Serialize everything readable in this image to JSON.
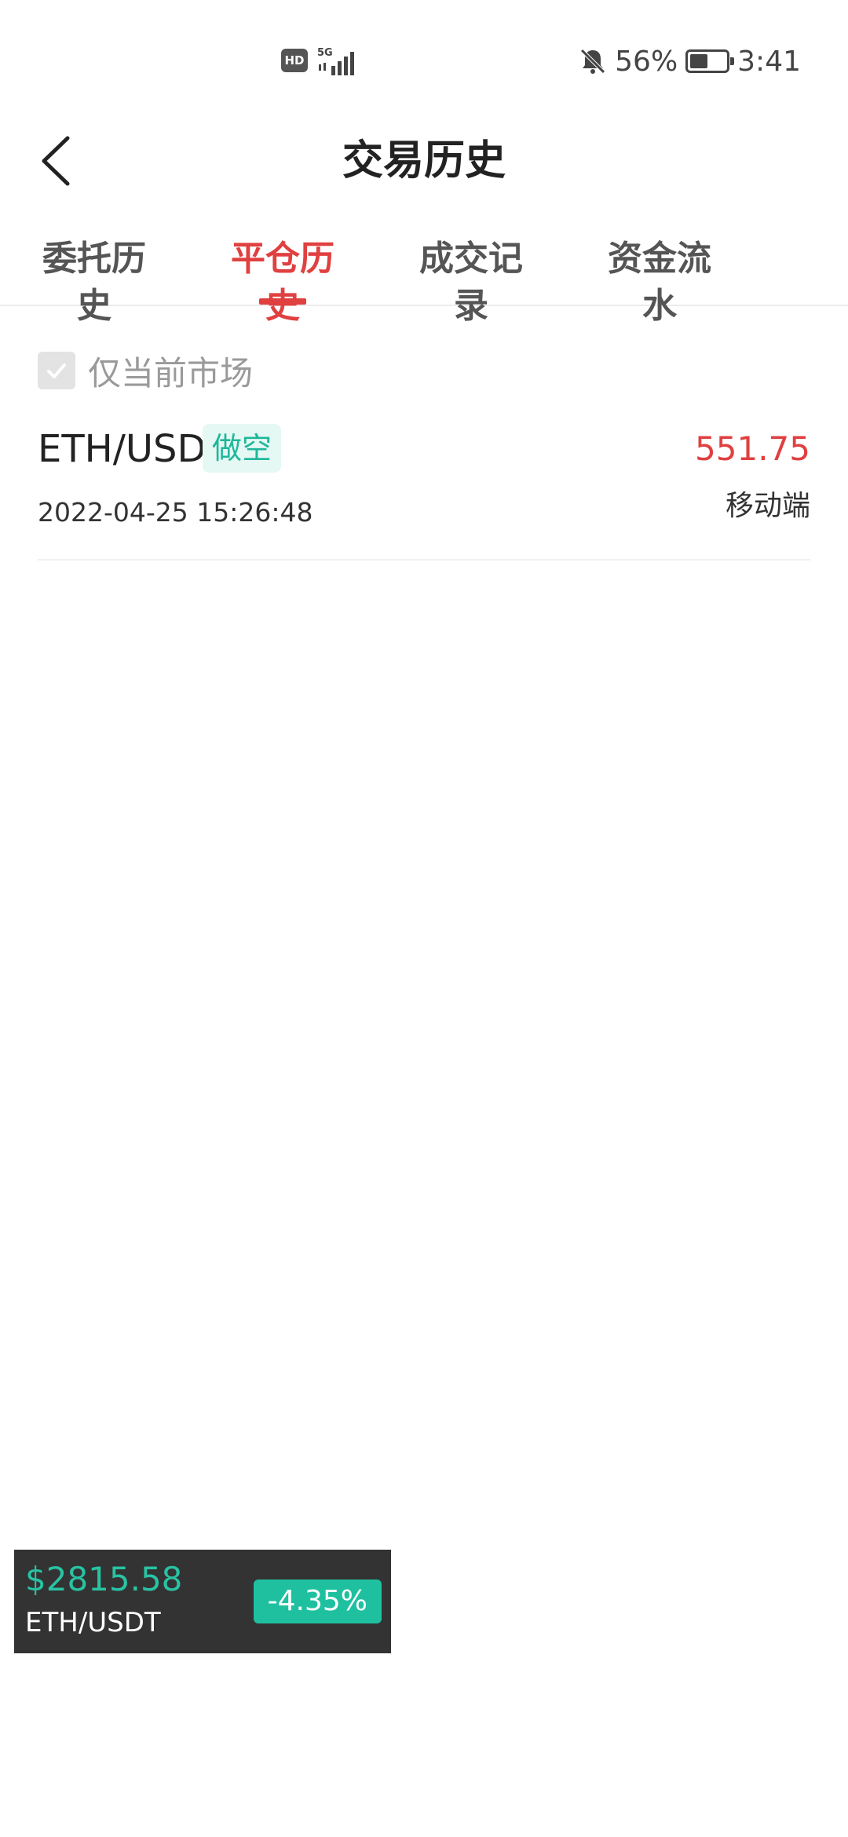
{
  "status_bar": {
    "hd_label": "HD",
    "network": "5G",
    "battery_percent": "56%",
    "time": "3:41",
    "battery_level": 0.56
  },
  "header": {
    "title": "交易历史",
    "back_icon": "chevron-left-icon"
  },
  "tabs": [
    {
      "label": "委托历史",
      "active": false
    },
    {
      "label": "平仓历史",
      "active": true
    },
    {
      "label": "成交记录",
      "active": false
    },
    {
      "label": "资金流水",
      "active": false
    }
  ],
  "filter": {
    "label": "仅当前市场",
    "checked": true
  },
  "records": [
    {
      "symbol": "ETH/USD",
      "side": "做空",
      "pnl": "551.75",
      "time": "2022-04-25 15:26:48",
      "source": "移动端"
    }
  ],
  "ticker": {
    "price": "$2815.58",
    "pair": "ETH/USDT",
    "change": "-4.35%"
  },
  "colors": {
    "accent_red": "#e04040",
    "accent_green": "#1fc0a0",
    "ticker_bg": "#333333"
  }
}
